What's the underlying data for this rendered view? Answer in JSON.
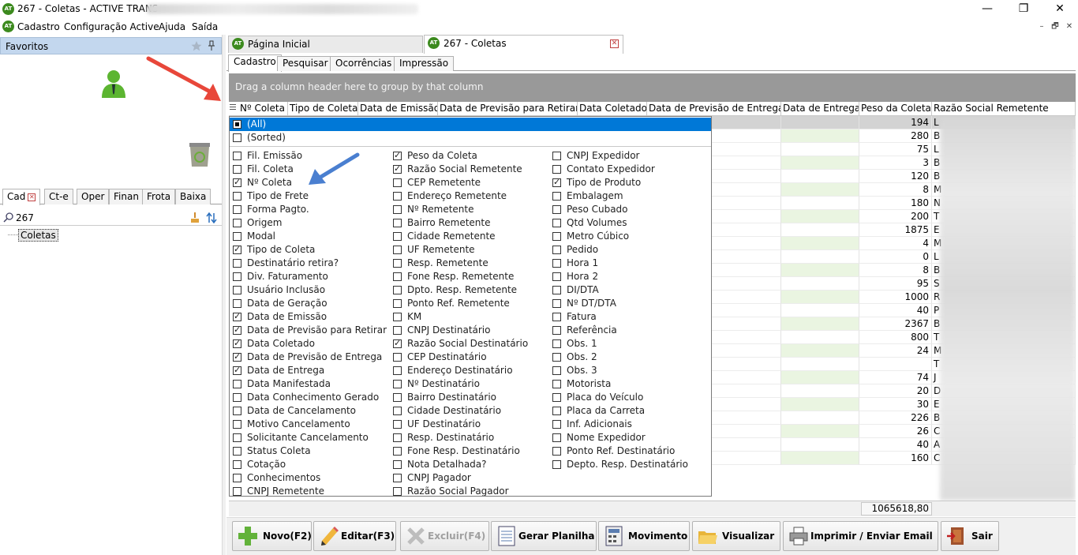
{
  "window": {
    "title": "267 - Coletas - ACTIVE TRANS -",
    "logo_text": "AT",
    "minimize": "—",
    "restore": "❐",
    "close": "✕"
  },
  "menu": {
    "items": [
      "Cadastro",
      "Configuração Active",
      "Ajuda",
      "Saída"
    ],
    "mdi": [
      "–",
      "🗗",
      "✕"
    ]
  },
  "left_panel": {
    "favorites_title": "Favoritos",
    "tabs": [
      "Cad",
      "Ct-e",
      "Oper",
      "Finan",
      "Frota",
      "Baixa"
    ],
    "search_value": "267",
    "tree_item": "Coletas"
  },
  "doc_tabs": [
    "Página Inicial",
    "267 - Coletas"
  ],
  "sub_tabs": [
    "Cadastro",
    "Pesquisar",
    "Ocorrências",
    "Impressão"
  ],
  "grid": {
    "group_hint": "Drag a column header here to group by that column",
    "columns": [
      "Nº Coleta",
      "Tipo de Coleta",
      "Data de Emissão",
      "Data de Previsão para Retirar",
      "Data Coletado",
      "Data de Previsão de Entrega",
      "Data de Entrega",
      "Peso da Coleta",
      "Razão Social Remetente"
    ],
    "rows": [
      {
        "peso": "194",
        "rs": "L"
      },
      {
        "peso": "280",
        "rs": "B"
      },
      {
        "peso": "75",
        "rs": "L"
      },
      {
        "peso": "3",
        "rs": "B"
      },
      {
        "peso": "120",
        "rs": "B"
      },
      {
        "peso": "8",
        "rs": "M"
      },
      {
        "peso": "180",
        "rs": "N"
      },
      {
        "peso": "200",
        "rs": "T"
      },
      {
        "peso": "1875",
        "rs": "E"
      },
      {
        "peso": "4",
        "rs": "M"
      },
      {
        "peso": "0",
        "rs": "L"
      },
      {
        "peso": "8",
        "rs": "B"
      },
      {
        "peso": "95",
        "rs": "S"
      },
      {
        "peso": "1000",
        "rs": "R"
      },
      {
        "peso": "40",
        "rs": "P"
      },
      {
        "peso": "2367",
        "rs": "B"
      },
      {
        "peso": "800",
        "rs": "T"
      },
      {
        "peso": "24",
        "rs": "M"
      },
      {
        "peso": "",
        "rs": "T"
      },
      {
        "peso": "74",
        "rs": "J"
      },
      {
        "peso": "20",
        "rs": "D"
      },
      {
        "peso": "30",
        "rs": "E"
      },
      {
        "peso": "226",
        "rs": "B"
      },
      {
        "peso": "26",
        "rs": "C"
      },
      {
        "peso": "40",
        "rs": "A"
      },
      {
        "peso": "160",
        "rs": "C"
      }
    ],
    "total_peso": "1065618,80"
  },
  "toolbar": {
    "buttons": [
      {
        "label": "Novo(F2)",
        "icon": "plus-icon",
        "enabled": true
      },
      {
        "label": "Editar(F3)",
        "icon": "pencil-icon",
        "enabled": true
      },
      {
        "label": "Excluir(F4)",
        "icon": "x-icon",
        "enabled": false
      },
      {
        "label": "Gerar Planilha",
        "icon": "spreadsheet-icon",
        "enabled": true
      },
      {
        "label": "Movimento",
        "icon": "calculator-icon",
        "enabled": true
      },
      {
        "label": "Visualizar",
        "icon": "folder-icon",
        "enabled": true
      },
      {
        "label": "Imprimir / Enviar Email",
        "icon": "printer-icon",
        "enabled": true
      },
      {
        "label": "Sair",
        "icon": "exit-door-icon",
        "enabled": true
      }
    ]
  },
  "column_chooser": {
    "all_label": "(All)",
    "sorted_label": "(Sorted)",
    "columns": [
      [
        {
          "label": "Fil. Emissão",
          "checked": false
        },
        {
          "label": "Fil. Coleta",
          "checked": false
        },
        {
          "label": "Nº Coleta",
          "checked": true
        },
        {
          "label": "Tipo de Frete",
          "checked": false
        },
        {
          "label": "Forma Pagto.",
          "checked": false
        },
        {
          "label": "Origem",
          "checked": false
        },
        {
          "label": "Modal",
          "checked": false
        },
        {
          "label": "Tipo de Coleta",
          "checked": true
        },
        {
          "label": "Destinatário retira?",
          "checked": false
        },
        {
          "label": "Div. Faturamento",
          "checked": false
        },
        {
          "label": "Usuário Inclusão",
          "checked": false
        },
        {
          "label": "Data de Geração",
          "checked": false
        },
        {
          "label": "Data de Emissão",
          "checked": true
        },
        {
          "label": "Data de Previsão para Retirar",
          "checked": true
        },
        {
          "label": "Data Coletado",
          "checked": true
        },
        {
          "label": "Data de Previsão de Entrega",
          "checked": true
        },
        {
          "label": "Data de Entrega",
          "checked": true
        },
        {
          "label": "Data Manifestada",
          "checked": false
        },
        {
          "label": "Data Conhecimento Gerado",
          "checked": false
        },
        {
          "label": "Data de Cancelamento",
          "checked": false
        },
        {
          "label": "Motivo Cancelamento",
          "checked": false
        },
        {
          "label": "Solicitante Cancelamento",
          "checked": false
        },
        {
          "label": "Status Coleta",
          "checked": false
        },
        {
          "label": "Cotação",
          "checked": false
        },
        {
          "label": "Conhecimentos",
          "checked": false
        },
        {
          "label": "CNPJ Remetente",
          "checked": false
        }
      ],
      [
        {
          "label": "Peso da Coleta",
          "checked": true
        },
        {
          "label": "Razão Social Remetente",
          "checked": true
        },
        {
          "label": "CEP Remetente",
          "checked": false
        },
        {
          "label": "Endereço Remetente",
          "checked": false
        },
        {
          "label": "Nº Remetente",
          "checked": false
        },
        {
          "label": "Bairro Remetente",
          "checked": false
        },
        {
          "label": "Cidade Remetente",
          "checked": false
        },
        {
          "label": "UF Remetente",
          "checked": false
        },
        {
          "label": "Resp. Remetente",
          "checked": false
        },
        {
          "label": "Fone Resp. Remetente",
          "checked": false
        },
        {
          "label": "Dpto. Resp. Remetente",
          "checked": false
        },
        {
          "label": "Ponto Ref. Remetente",
          "checked": false
        },
        {
          "label": "KM",
          "checked": false
        },
        {
          "label": "CNPJ Destinatário",
          "checked": false
        },
        {
          "label": "Razão Social Destinatário",
          "checked": true
        },
        {
          "label": "CEP Destinatário",
          "checked": false
        },
        {
          "label": "Endereço Destinatário",
          "checked": false
        },
        {
          "label": "Nº Destinatário",
          "checked": false
        },
        {
          "label": "Bairro Destinatário",
          "checked": false
        },
        {
          "label": "Cidade Destinatário",
          "checked": false
        },
        {
          "label": "UF Destinatário",
          "checked": false
        },
        {
          "label": "Resp. Destinatário",
          "checked": false
        },
        {
          "label": "Fone Resp. Destinatário",
          "checked": false
        },
        {
          "label": "Nota Detalhada?",
          "checked": false
        },
        {
          "label": "CNPJ Pagador",
          "checked": false
        },
        {
          "label": "Razão Social Pagador",
          "checked": false
        }
      ],
      [
        {
          "label": "CNPJ Expedidor",
          "checked": false
        },
        {
          "label": "Contato Expedidor",
          "checked": false
        },
        {
          "label": "Tipo de Produto",
          "checked": true
        },
        {
          "label": "Embalagem",
          "checked": false
        },
        {
          "label": "Peso Cubado",
          "checked": false
        },
        {
          "label": "Qtd Volumes",
          "checked": false
        },
        {
          "label": "Metro Cúbico",
          "checked": false
        },
        {
          "label": "Pedido",
          "checked": false
        },
        {
          "label": "Hora 1",
          "checked": false
        },
        {
          "label": "Hora 2",
          "checked": false
        },
        {
          "label": "DI/DTA",
          "checked": false
        },
        {
          "label": "Nº DT/DTA",
          "checked": false
        },
        {
          "label": "Fatura",
          "checked": false
        },
        {
          "label": "Referência",
          "checked": false
        },
        {
          "label": "Obs. 1",
          "checked": false
        },
        {
          "label": "Obs. 2",
          "checked": false
        },
        {
          "label": "Obs. 3",
          "checked": false
        },
        {
          "label": "Motorista",
          "checked": false
        },
        {
          "label": "Placa do Veículo",
          "checked": false
        },
        {
          "label": "Placa da Carreta",
          "checked": false
        },
        {
          "label": "Inf. Adicionais",
          "checked": false
        },
        {
          "label": "Nome Expedidor",
          "checked": false
        },
        {
          "label": "Ponto Ref. Destinatário",
          "checked": false
        },
        {
          "label": "Depto. Resp. Destinatário",
          "checked": false
        }
      ]
    ]
  },
  "colors": {
    "accent_blue": "#0078d7",
    "favorites_header": "#c3d7ee",
    "group_panel": "#999999",
    "row_alt_green": "#eaf5e1",
    "red_arrow": "#e8473a",
    "blue_arrow": "#4a7fd0"
  }
}
